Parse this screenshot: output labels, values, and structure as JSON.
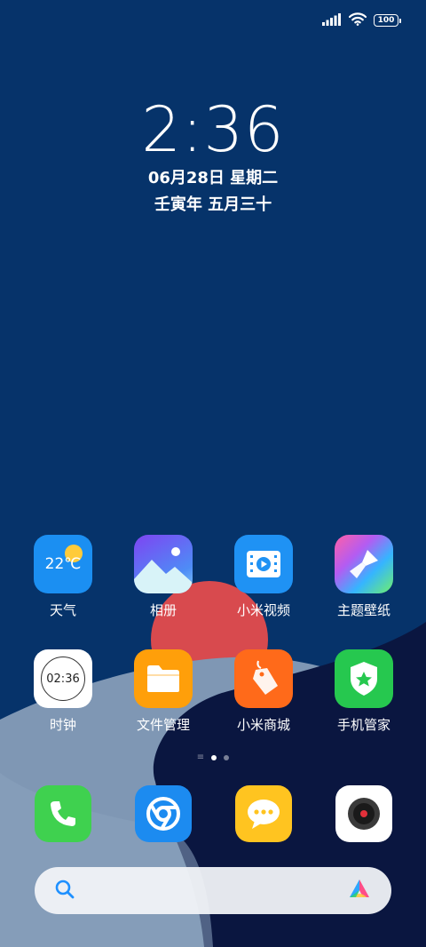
{
  "status_bar": {
    "battery_level": "100",
    "signal_icon": "signal-bars-icon",
    "wifi_icon": "wifi-icon"
  },
  "lockscreen": {
    "time": "2:36",
    "date": "06月28日 星期二",
    "lunar_date": "壬寅年 五月三十"
  },
  "apps_row1": [
    {
      "label": "天气",
      "icon": "weather-icon",
      "icon_text": "22℃"
    },
    {
      "label": "相册",
      "icon": "gallery-icon"
    },
    {
      "label": "小米视频",
      "icon": "video-icon"
    },
    {
      "label": "主题壁纸",
      "icon": "theme-brush-icon"
    }
  ],
  "apps_row2": [
    {
      "label": "时钟",
      "icon": "clock-icon",
      "icon_text": "02:36"
    },
    {
      "label": "文件管理",
      "icon": "folder-icon"
    },
    {
      "label": "小米商城",
      "icon": "shop-tag-icon"
    },
    {
      "label": "手机管家",
      "icon": "security-shield-icon"
    }
  ],
  "dock": [
    {
      "name": "phone",
      "icon": "phone-icon"
    },
    {
      "name": "browser",
      "icon": "browser-icon"
    },
    {
      "name": "messages",
      "icon": "message-icon"
    },
    {
      "name": "camera",
      "icon": "camera-icon"
    }
  ],
  "page_indicator": {
    "pages": 2,
    "current": 1
  },
  "search": {
    "icon": "search-icon",
    "assistant_icon": "assistant-icon"
  },
  "colors": {
    "wallpaper_bg": "#06336a",
    "accent_red": "#d84a4e",
    "hill_light": "#7f97b4",
    "hill_dark": "#0a1640"
  }
}
